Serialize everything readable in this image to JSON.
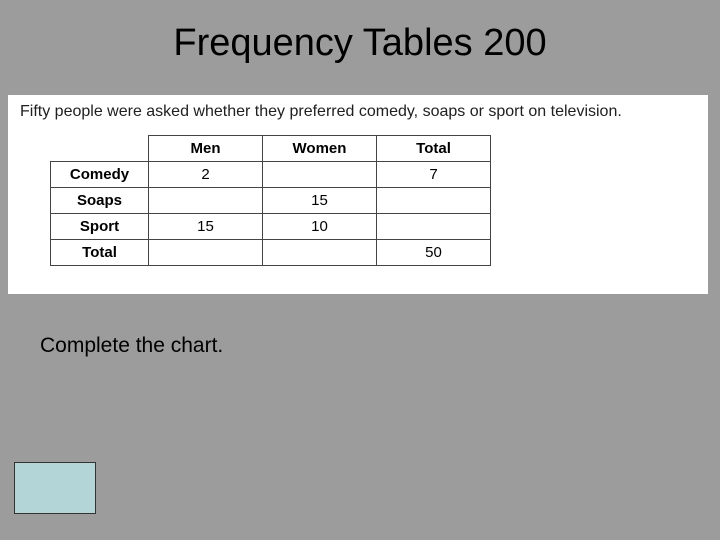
{
  "title": "Frequency Tables  200",
  "question": "Fifty people were asked whether they preferred comedy, soaps or sport on television.",
  "instruction": "Complete the chart.",
  "chart_data": {
    "type": "table",
    "title": "",
    "columns": [
      "Men",
      "Women",
      "Total"
    ],
    "rows": [
      "Comedy",
      "Soaps",
      "Sport",
      "Total"
    ],
    "values": {
      "comedy_men": "2",
      "comedy_women": "",
      "comedy_total": "7",
      "soaps_men": "",
      "soaps_women": "15",
      "soaps_total": "",
      "sport_men": "15",
      "sport_women": "10",
      "sport_total": "",
      "total_men": "",
      "total_women": "",
      "total_total": "50"
    }
  }
}
